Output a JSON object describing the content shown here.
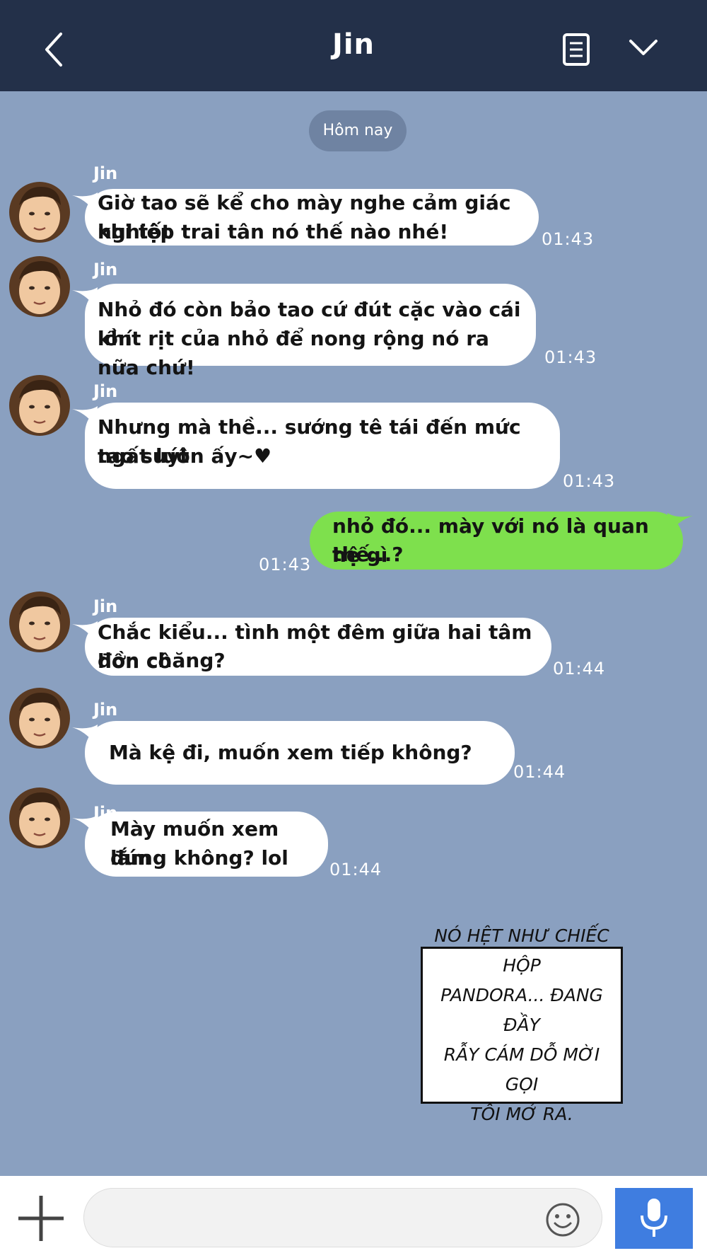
{
  "header": {
    "title": "Jin",
    "back_icon": "chevron-left-icon",
    "notes_icon": "notes-icon",
    "menu_icon": "chevron-down-icon",
    "background": "#233049"
  },
  "chat": {
    "background": "#8aa0c0",
    "date_label": "Hôm nay",
    "messages": [
      {
        "sender": "Jin",
        "line1": "Giờ tao sẽ kể cho mày nghe cảm giác khi tốt",
        "line2": "nghiệp trai tân nó thế nào nhé!",
        "time": "01:43",
        "direction": "received"
      },
      {
        "sender": "Jin",
        "line1": "Nhỏ đó còn bảo tao cứ đút cặc vào cái lồn",
        "line2": "khít rịt của nhỏ để nong rộng nó ra nữa chứ!",
        "time": "01:43",
        "direction": "received"
      },
      {
        "sender": "Jin",
        "line1": "Nhưng mà thề... sướng tê tái đến mức tao suýt",
        "line2": "ngất luôn ấy~♥",
        "time": "01:43",
        "direction": "received"
      },
      {
        "sender": "",
        "line1": "nhỏ đó... mày với nó là quan hệ gì",
        "line2": "thế...?",
        "time": "01:43",
        "direction": "sent"
      },
      {
        "sender": "Jin",
        "line1": "Chắc kiểu... tình một đêm giữa hai tâm hồn cô",
        "line2": "đơn chăng?",
        "time": "01:44",
        "direction": "received"
      },
      {
        "sender": "Jin",
        "line1": "Mà kệ đi, muốn xem tiếp không?",
        "line2": "",
        "time": "01:44",
        "direction": "received"
      },
      {
        "sender": "Jin",
        "line1": "Mày muốn xem lắm",
        "line2": "đúng không? lol",
        "time": "01:44",
        "direction": "received"
      }
    ]
  },
  "narration": {
    "lines": [
      "NÓ HỆT NHƯ CHIẾC HỘP",
      "PANDORA... ĐANG ĐẦY",
      "RẪY CÁM DỖ MỜI GỌI",
      "TÔI MỞ RA."
    ]
  },
  "input": {
    "plus_icon": "plus-icon",
    "emoji_icon": "smiley-icon",
    "mic_icon": "microphone-icon",
    "placeholder": "",
    "mic_color": "#3f7de0"
  },
  "colors": {
    "sent_bubble": "#7ee04d",
    "received_bubble": "#ffffff"
  }
}
